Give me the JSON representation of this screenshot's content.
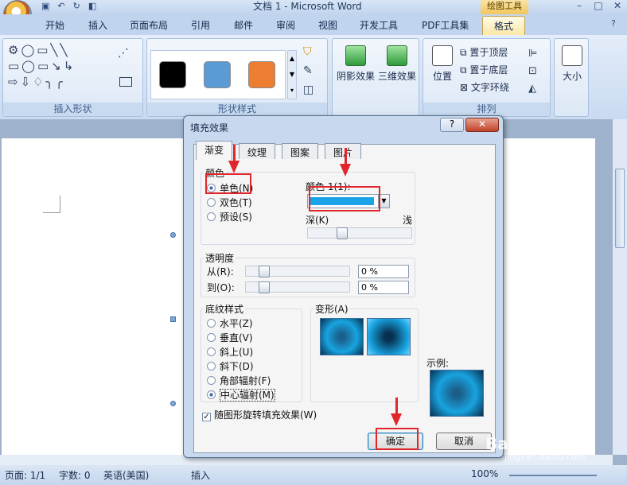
{
  "window": {
    "title": "文档 1 - Microsoft Word",
    "context_tab": "绘图工具"
  },
  "tabs": [
    "开始",
    "插入",
    "页面布局",
    "引用",
    "邮件",
    "审阅",
    "视图",
    "开发工具",
    "PDF工具集",
    "格式"
  ],
  "ribbon": {
    "groups": [
      "插入形状",
      "形状样式",
      "排列"
    ],
    "big_buttons": {
      "shadow": "阴影效果",
      "threed": "三维效果",
      "position": "位置",
      "size": "大小"
    },
    "arrange": {
      "front": "置于顶层",
      "back": "置于底层",
      "wrap": "文字环绕"
    },
    "swatch_colors": [
      "#000000",
      "#5b9bd5",
      "#ed7d31"
    ]
  },
  "dialog": {
    "title": "填充效果",
    "tabs": [
      "渐变",
      "纹理",
      "图案",
      "图片"
    ],
    "color_section": "颜色",
    "color_options": [
      "单色(N)",
      "双色(T)",
      "预设(S)"
    ],
    "color1_label": "颜色 1(1):",
    "color1_value": "#1aa3e6",
    "dark_label": "深(K)",
    "light_label": "浅",
    "transparency": "透明度",
    "from_label": "从(R):",
    "to_label": "到(O):",
    "from_value": "0 %",
    "to_value": "0 %",
    "shading_styles": "底纹样式",
    "styles": [
      "水平(Z)",
      "垂直(V)",
      "斜上(U)",
      "斜下(D)",
      "角部辐射(F)",
      "中心辐射(M)"
    ],
    "variants": "变形(A)",
    "sample": "示例:",
    "rotate_checkbox": "随图形旋转填充效果(W)",
    "ok": "确定",
    "cancel": "取消",
    "help": "?",
    "close": "✕"
  },
  "status": {
    "page": "页面: 1/1",
    "words": "字数: 0",
    "lang": "英语(美国)",
    "mode": "插入",
    "zoom": "100%"
  },
  "watermark": {
    "logo": "Baidu经验",
    "url": "jingyan.baidu.com"
  }
}
